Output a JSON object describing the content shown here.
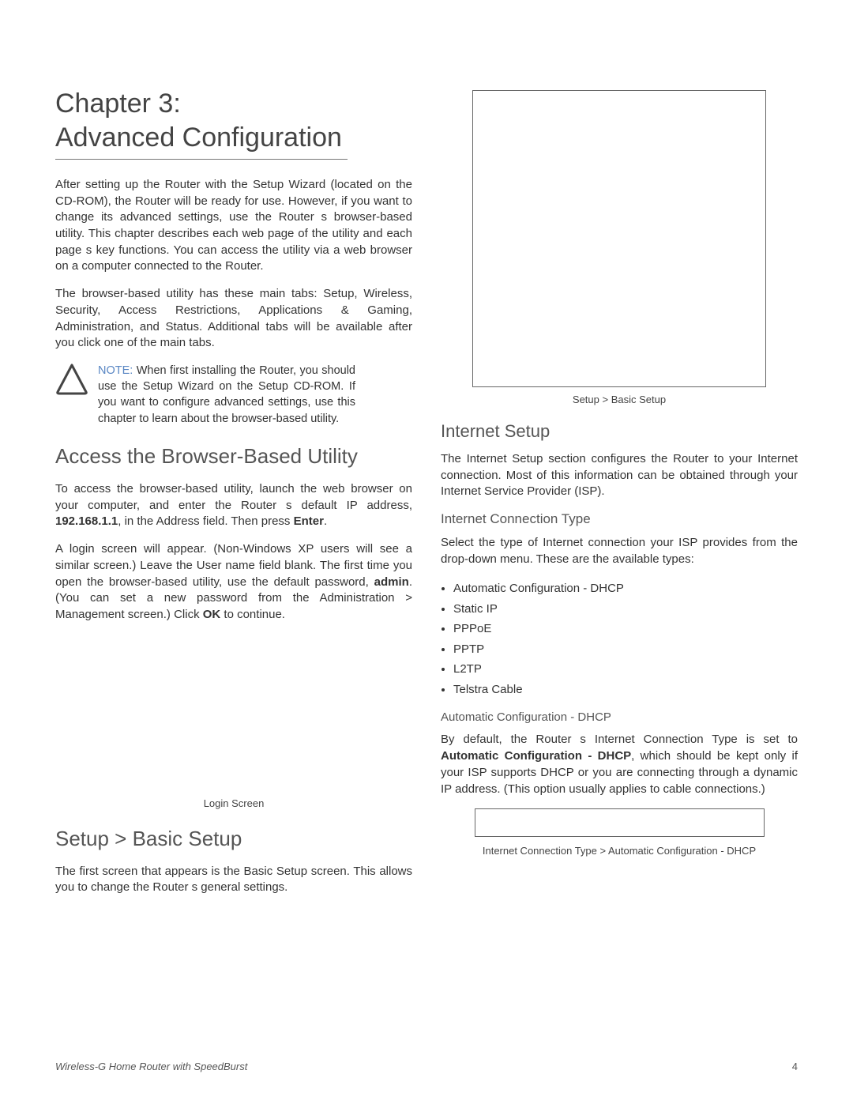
{
  "chapter": {
    "line1": "Chapter 3:",
    "line2": "Advanced Configuration"
  },
  "left": {
    "p1": "After setting up the Router with the Setup Wizard (located on the CD-ROM), the Router will be ready for use. However, if you want to change its advanced settings, use the Router s browser-based utility. This chapter describes each web page of the utility and each page s key functions. You can access the utility via a web browser on a computer connected to the Router.",
    "p2": "The browser-based utility has these main tabs: Setup, Wireless, Security, Access Restrictions, Applications & Gaming, Administration, and Status. Additional tabs will be available after you click one of the main tabs.",
    "note_label": "NOTE:",
    "note_text": " When first installing the Router, you should use the Setup Wizard on the Setup CD-ROM. If you want to configure advanced settings, use this chapter to learn about the browser-based utility.",
    "h_access": "Access the Browser-Based Utility",
    "p3a": "To access the browser-based utility, launch the web browser on your computer, and enter the Router s default IP address, ",
    "p3b_ip": "192.168.1.1",
    "p3c": ", in the Address field. Then press ",
    "p3d_enter": "Enter",
    "p3e": ".",
    "p4a": "A login screen will appear. (Non-Windows XP users will see a similar screen.) Leave the ",
    "p4b_user": "User name",
    "p4c": " field blank. The first time you open the browser-based utility, use the default password, ",
    "p4d_admin": "admin",
    "p4e": ". (You can set a new password from the Administration > Management screen.) Click ",
    "p4f_ok": "OK",
    "p4g": " to continue.",
    "caption_login": "Login Screen",
    "h_setup": "Setup > Basic Setup",
    "p5a": "The first screen that appears is the ",
    "p5b_basic": "Basic Setup",
    "p5c": " screen. This allows you to change the Router s general settings."
  },
  "right": {
    "caption_basic": "Setup > Basic Setup",
    "h_internet": "Internet Setup",
    "p1": "The Internet Setup section configures the Router to your Internet connection. Most of this information can be obtained through your Internet Service Provider (ISP).",
    "h_conn_type": "Internet Connection Type",
    "p2": "Select the type of Internet connection your ISP provides from the drop-down menu. These are the available types:",
    "types": [
      "Automatic Configuration - DHCP",
      "Static IP",
      "PPPoE",
      "PPTP",
      "L2TP",
      "Telstra Cable"
    ],
    "h_dhcp": "Automatic Configuration - DHCP",
    "p3a": "By default, the Router s Internet Connection Type is set to ",
    "p3b_bold": "Automatic Configuration - DHCP",
    "p3c": ", which should be kept only if your ISP supports DHCP or you are connecting through a dynamic IP address. (This option usually applies to cable connections.)",
    "caption_dhcp": "Internet Connection Type > Automatic Configuration - DHCP"
  },
  "footer": {
    "left": "Wireless-G Home Router with SpeedBurst",
    "right": "4"
  }
}
